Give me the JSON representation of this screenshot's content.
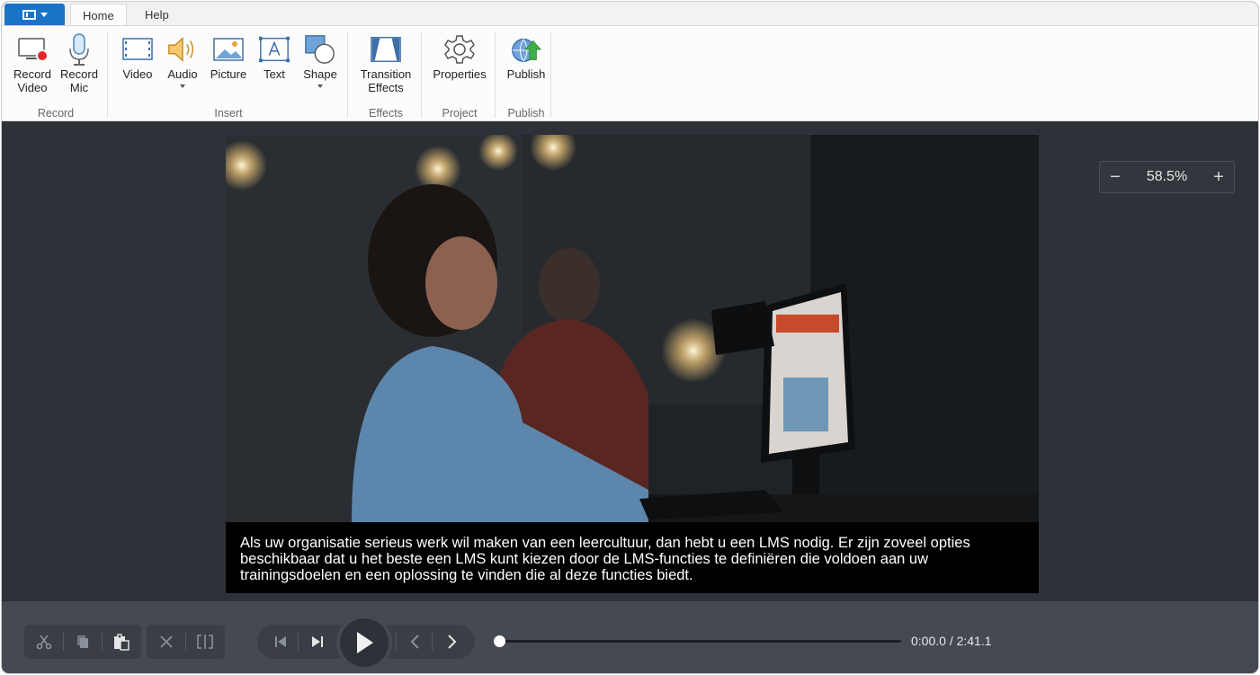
{
  "tabs": {
    "home": "Home",
    "help": "Help"
  },
  "ribbon": {
    "record_video": "Record\nVideo",
    "record_mic": "Record\nMic",
    "video": "Video",
    "audio": "Audio",
    "picture": "Picture",
    "text": "Text",
    "shape": "Shape",
    "transition_effects": "Transition\nEffects",
    "properties": "Properties",
    "publish": "Publish",
    "groups": {
      "record": "Record",
      "insert": "Insert",
      "effects": "Effects",
      "project": "Project",
      "publish": "Publish"
    }
  },
  "canvas": {
    "caption": "Als uw organisatie serieus werk wil maken van een leercultuur, dan hebt u een LMS nodig. Er zijn zoveel opties beschikbaar dat u het beste een LMS kunt kiezen door de LMS-functies te definiëren die voldoen aan uw trainingsdoelen en een oplossing te vinden die al deze functies biedt.",
    "zoom_value": "58.5%",
    "zoom_minus": "−",
    "zoom_plus": "+"
  },
  "playback": {
    "time": "0:00.0 / 2:41.1",
    "progress": 0.0
  },
  "colors": {
    "accent": "#1a73c6",
    "stage_bg": "#2e3238",
    "bar_bg": "#454a52"
  },
  "icons": {
    "cut": "scissors-icon",
    "copy": "copy-icon",
    "paste": "paste-icon",
    "delete": "x-icon",
    "split": "split-icon",
    "prev": "skip-back-icon",
    "next": "skip-forward-icon",
    "play": "play-icon"
  }
}
